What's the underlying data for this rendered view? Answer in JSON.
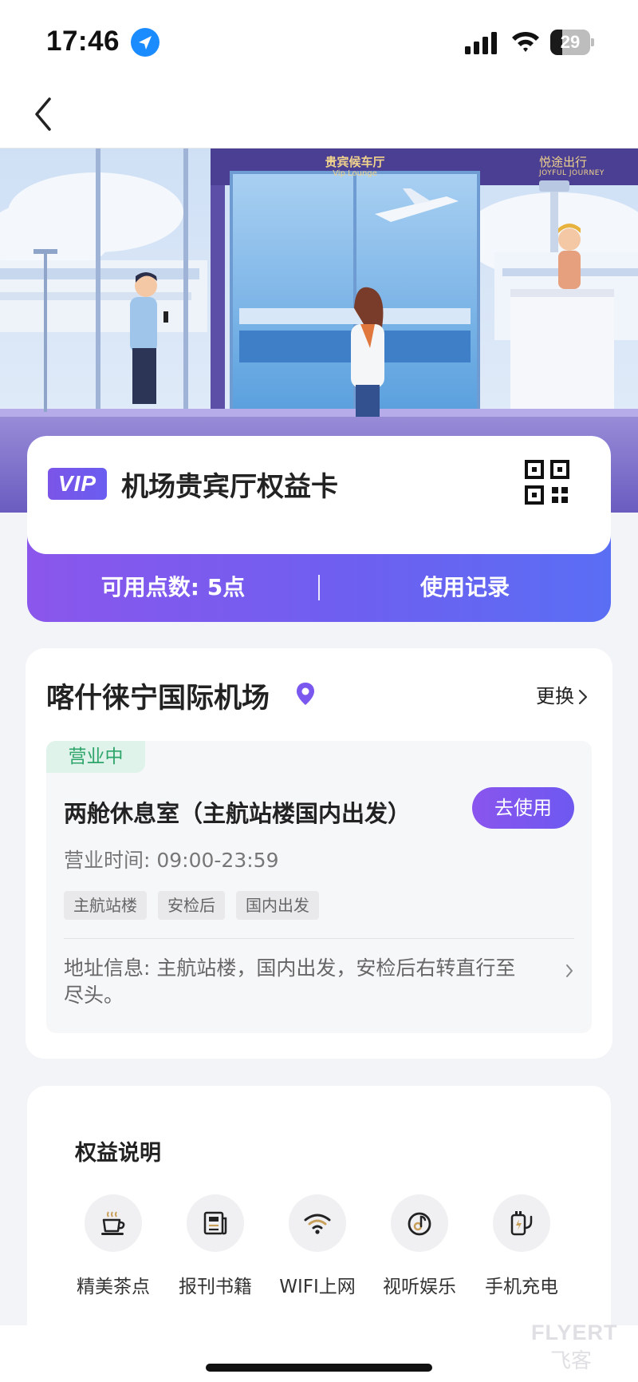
{
  "status_bar": {
    "time": "17:46",
    "battery_level": "29",
    "battery_fraction": 0.29
  },
  "hero": {
    "lounge_sign_cn": "贵宾候车厅",
    "lounge_sign_en": "Vip Lounge",
    "brand_cn": "悦途出行",
    "brand_en": "JOYFUL JOURNEY"
  },
  "card": {
    "badge": "VIP",
    "title": "机场贵宾厅权益卡",
    "points": "可用点数: 5点",
    "records": "使用记录"
  },
  "airport": {
    "name": "喀什徕宁国际机场",
    "change": "更换",
    "lounge": {
      "status": "营业中",
      "name": "两舱休息室（主航站楼国内出发）",
      "use_button": "去使用",
      "hours": "营业时间: 09:00-23:59",
      "tags": [
        "主航站楼",
        "安检后",
        "国内出发"
      ],
      "address": "地址信息: 主航站楼，国内出发，安检后右转直行至尽头。"
    }
  },
  "benefits": {
    "title": "权益说明",
    "items": [
      {
        "label": "精美茶点",
        "icon": "tea-icon"
      },
      {
        "label": "报刊书籍",
        "icon": "newspaper-icon"
      },
      {
        "label": "WIFI上网",
        "icon": "wifi-icon"
      },
      {
        "label": "视听娱乐",
        "icon": "music-icon"
      },
      {
        "label": "手机充电",
        "icon": "charging-icon"
      }
    ]
  },
  "watermark": {
    "en": "FLYERT",
    "cn": "飞客"
  },
  "colors": {
    "accent": "#7a57ee",
    "open_green": "#2ea56a",
    "background": "#f3f4f8"
  }
}
